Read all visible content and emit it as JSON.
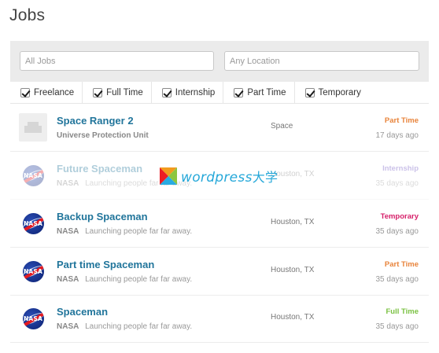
{
  "page": {
    "title": "Jobs"
  },
  "filters": {
    "keywords_placeholder": "All Jobs",
    "location_placeholder": "Any Location"
  },
  "job_types": [
    {
      "label": "Freelance",
      "checked": true
    },
    {
      "label": "Full Time",
      "checked": true
    },
    {
      "label": "Internship",
      "checked": true
    },
    {
      "label": "Part Time",
      "checked": true
    },
    {
      "label": "Temporary",
      "checked": true
    }
  ],
  "jobs": [
    {
      "title": "Space Ranger 2",
      "company": "Universe Protection Unit",
      "tagline": "",
      "location": "Space",
      "type": "Part Time",
      "type_color": "#e8833a",
      "date": "17 days ago",
      "logo": "building-icon"
    },
    {
      "title": "Future Spaceman",
      "company": "NASA",
      "tagline": "Launching people far far away.",
      "location": "Houston, TX",
      "type": "Internship",
      "type_color": "#6b4fbf",
      "date": "35 days ago",
      "logo": "nasa-logo-icon"
    },
    {
      "title": "Backup Spaceman",
      "company": "NASA",
      "tagline": "Launching people far far away.",
      "location": "Houston, TX",
      "type": "Temporary",
      "type_color": "#d61f69",
      "date": "35 days ago",
      "logo": "nasa-logo-icon"
    },
    {
      "title": "Part time Spaceman",
      "company": "NASA",
      "tagline": "Launching people far far away.",
      "location": "Houston, TX",
      "type": "Part Time",
      "type_color": "#e8833a",
      "date": "35 days ago",
      "logo": "nasa-logo-icon"
    },
    {
      "title": "Spaceman",
      "company": "NASA",
      "tagline": "Launching people far far away.",
      "location": "Houston, TX",
      "type": "Full Time",
      "type_color": "#7ac142",
      "date": "35 days ago",
      "logo": "nasa-logo-icon"
    }
  ],
  "watermark": {
    "text": "wordpress",
    "cn": "大学"
  },
  "logo_text": "NASA"
}
